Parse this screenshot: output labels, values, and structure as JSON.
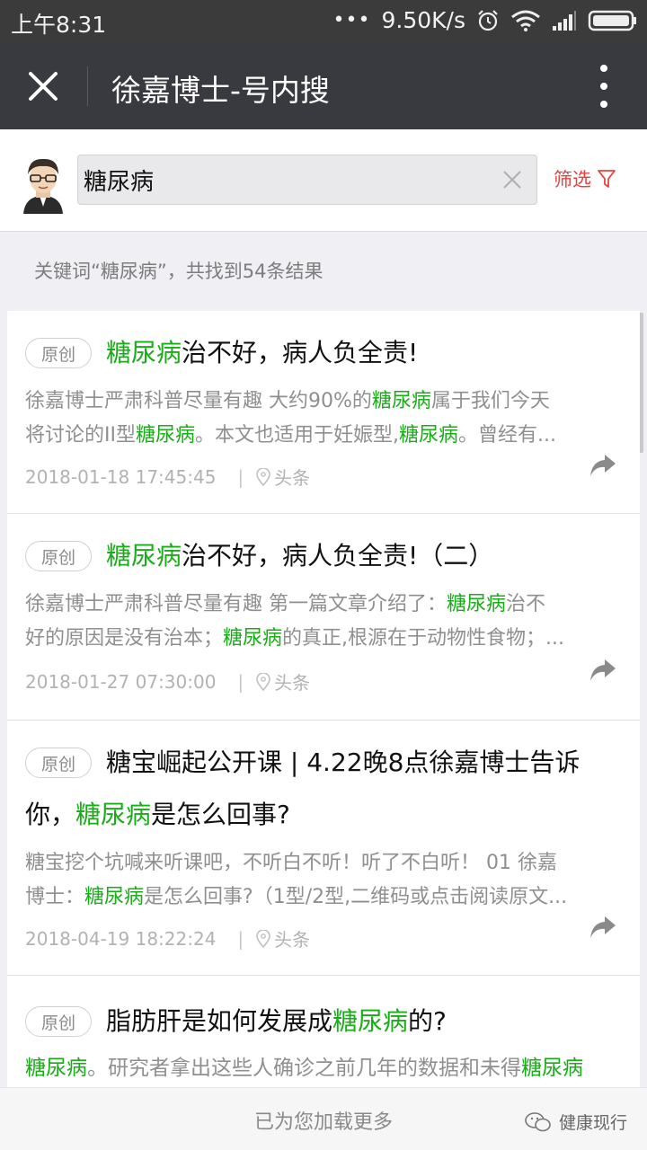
{
  "status_bar": {
    "time": "上午8:31",
    "speed": "9.50K/s",
    "more": "•••",
    "icons": [
      "alarm-icon",
      "wifi-icon",
      "signal-icon",
      "battery-icon"
    ]
  },
  "title_bar": {
    "title": "徐嘉博士-号内搜"
  },
  "search": {
    "query": "糖尿病",
    "filter_label": "筛选"
  },
  "summary": "关键词“糖尿病”，共找到54条结果",
  "colors": {
    "highlight": "#1aad19",
    "filter": "#e64340",
    "titlebar": "#393a3f"
  },
  "results": [
    {
      "tag": "原创",
      "title_pre": "",
      "title_hl": "糖尿病",
      "title_post": "治不好，病人负全责!",
      "desc_1": "徐嘉博士严肃科普尽量有趣 大约90%的",
      "desc_1_hl": "糖尿病",
      "desc_1_post": "属于我们今天",
      "desc_2": "将讨论的II型",
      "desc_2_hl": "糖尿病",
      "desc_2_mid": "。本文也适用于妊娠型,",
      "desc_2_hl2": "糖尿病",
      "desc_2_post": "。曾经有...",
      "date": "2018-01-18 17:45:45",
      "source": "头条"
    },
    {
      "tag": "原创",
      "title_pre": "",
      "title_hl": "糖尿病",
      "title_post": "治不好，病人负全责!（二）",
      "desc_1": "徐嘉博士严肃科普尽量有趣 第一篇文章介绍了：",
      "desc_1_hl": "糖尿病",
      "desc_1_post": "治不",
      "desc_2": "好的原因是没有治本；",
      "desc_2_hl": "糖尿病",
      "desc_2_mid": "的真正,根源在于动物性食物；...",
      "desc_2_hl2": "",
      "desc_2_post": "",
      "date": "2018-01-27 07:30:00",
      "source": "头条"
    },
    {
      "tag": "原创",
      "title_line1": "糖宝崛起公开课 | 4.22晚8点徐嘉博士告诉",
      "title_line2_pre": "你，",
      "title_line2_hl": "糖尿病",
      "title_line2_post": "是怎么回事?",
      "desc_1": "糖宝挖个坑喊来听课吧，不听白不听！听了不白听！ 01 徐嘉",
      "desc_2": "博士：",
      "desc_2_hl": "糖尿病",
      "desc_2_mid": "是怎么回事?（1型/2型,二维码或点击阅读原文...",
      "date": "2018-04-19 18:22:24",
      "source": "头条"
    },
    {
      "tag": "原创",
      "title_pre": "脂肪肝是如何发展成",
      "title_hl": "糖尿病",
      "title_post": "的?",
      "desc_1_hl": "糖尿病",
      "desc_1": "。研究者拿出这些人确诊之前几年的数据和未得",
      "desc_1_hl2": "糖尿病"
    }
  ],
  "load_more": "已为您加载更多",
  "watermark": "健康现行"
}
